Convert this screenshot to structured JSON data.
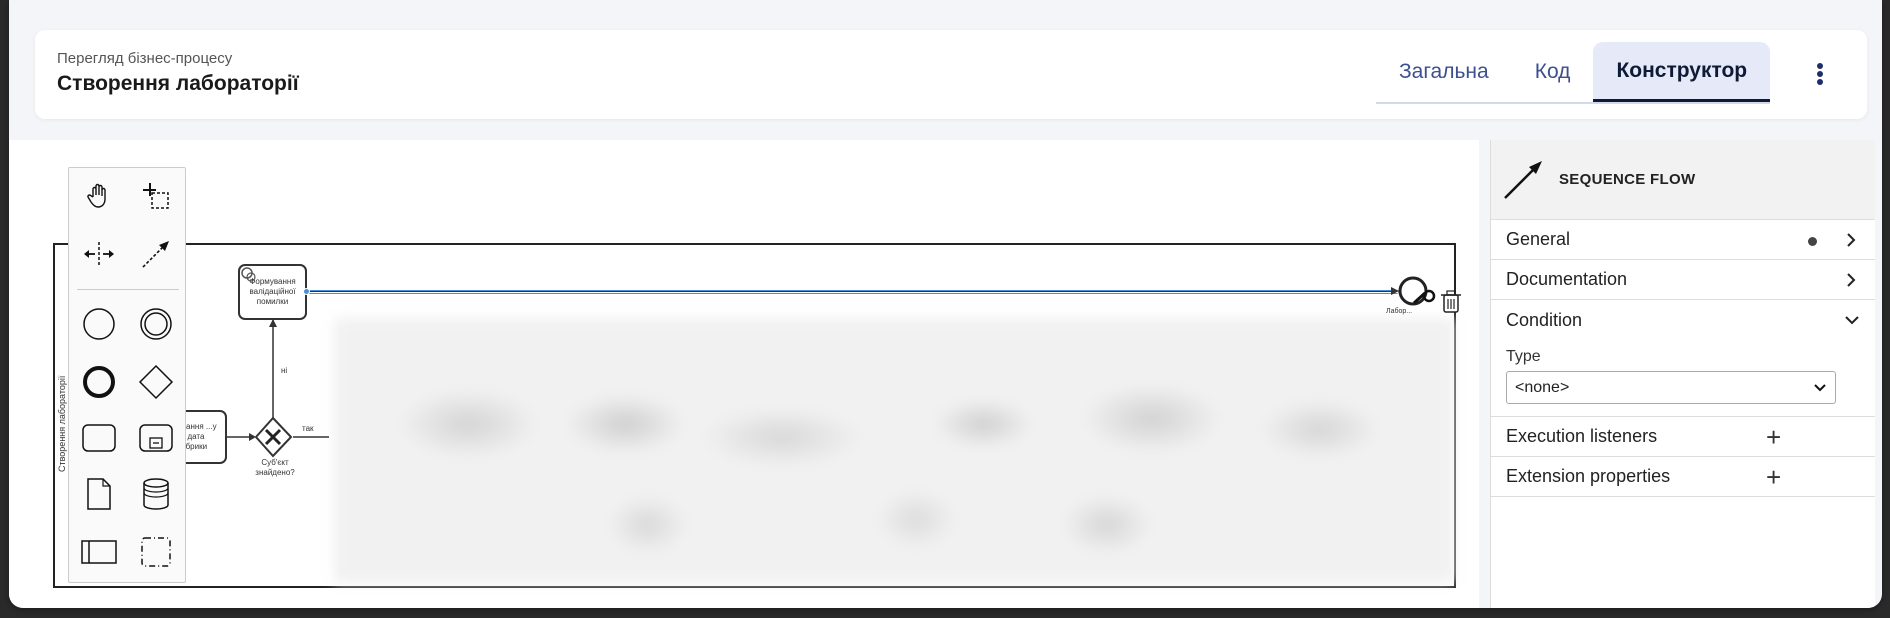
{
  "header": {
    "subtitle": "Перегляд бізнес-процесу",
    "title": "Створення лабораторії"
  },
  "tabs": [
    {
      "label": "Загальна",
      "active": false
    },
    {
      "label": "Код",
      "active": false
    },
    {
      "label": "Конструктор",
      "active": true
    }
  ],
  "diagram": {
    "pool_label": "Створення лабораторії",
    "task_validation": "Формування валідаційної помилки",
    "task_left": "...имання ...у з дата ...брики",
    "gateway_label": "Суб'єкт знайдено?",
    "flow_no": "ні",
    "flow_yes": "так",
    "end_label": "Лабор..."
  },
  "properties": {
    "element_type": "SEQUENCE FLOW",
    "groups": {
      "general": "General",
      "documentation": "Documentation",
      "condition": "Condition",
      "execution_listeners": "Execution listeners",
      "extension_properties": "Extension properties"
    },
    "condition_type_label": "Type",
    "condition_type_value": "<none>"
  },
  "palette_tools": [
    "hand-tool-icon",
    "lasso-tool-icon",
    "space-tool-icon",
    "global-connect-icon",
    "start-event-icon",
    "intermediate-event-icon",
    "end-event-icon",
    "gateway-icon",
    "task-icon",
    "subprocess-icon",
    "data-object-icon",
    "data-store-icon",
    "pool-icon",
    "group-icon"
  ],
  "colors": {
    "accent": "#3c4f8f",
    "selection": "#4a90d9",
    "active_tab_bg": "#e6e9f8"
  }
}
